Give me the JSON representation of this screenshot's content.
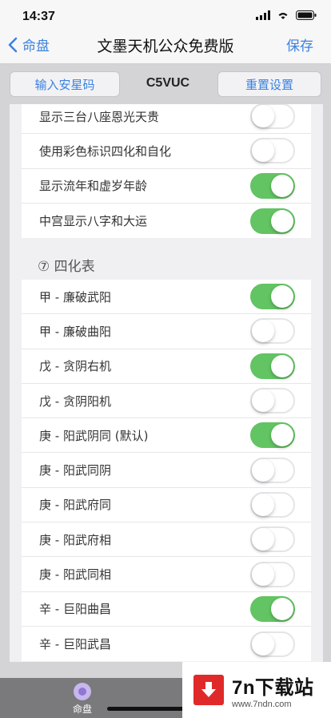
{
  "status": {
    "time": "14:37"
  },
  "nav": {
    "back_label": "命盘",
    "title": "文墨天机公众免费版",
    "save_label": "保存"
  },
  "toolbar": {
    "input_code_label": "输入安星码",
    "code": "C5VUC",
    "reset_label": "重置设置"
  },
  "settings_top": [
    {
      "label": "显示三台八座恩光天贵",
      "on": false
    },
    {
      "label": "使用彩色标识四化和自化",
      "on": false
    },
    {
      "label": "显示流年和虚岁年龄",
      "on": true
    },
    {
      "label": "中宫显示八字和大运",
      "on": true
    }
  ],
  "sihua_section": {
    "title": "⑦ 四化表",
    "items": [
      {
        "label": "甲 - 廉破武阳",
        "on": true
      },
      {
        "label": "甲 - 廉破曲阳",
        "on": false
      },
      {
        "label": "戊 - 贪阴右机",
        "on": true
      },
      {
        "label": "戊 - 贪阴阳机",
        "on": false
      },
      {
        "label": "庚 - 阳武阴同 (默认)",
        "on": true
      },
      {
        "label": "庚 - 阳武同阴",
        "on": false
      },
      {
        "label": "庚 - 阳武府同",
        "on": false
      },
      {
        "label": "庚 - 阳武府相",
        "on": false
      },
      {
        "label": "庚 - 阳武同相",
        "on": false
      },
      {
        "label": "辛 - 巨阳曲昌",
        "on": true
      },
      {
        "label": "辛 - 巨阳武昌",
        "on": false
      }
    ]
  },
  "tabbar": {
    "tab1_label": "命盘"
  },
  "watermark": {
    "title": "7n下载站",
    "url": "www.7ndn.com"
  },
  "colors": {
    "accent": "#3b82e0",
    "toggle_on": "#62c462"
  }
}
